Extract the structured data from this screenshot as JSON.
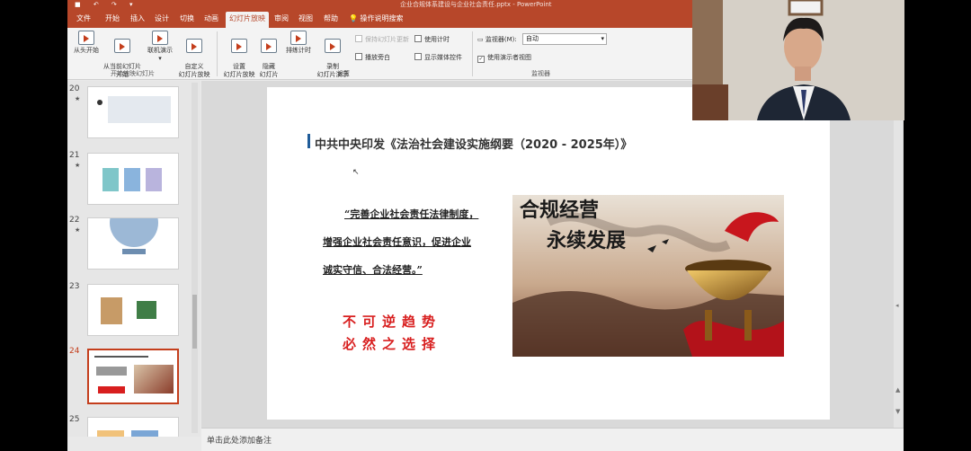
{
  "titlebar": {
    "quick_access": "■ ↶ ↷ ▾",
    "document": "企业合规体系建设与企业社会责任.pptx - PowerPoint"
  },
  "ribbon_tabs": [
    {
      "label": "文件"
    },
    {
      "label": "开始"
    },
    {
      "label": "插入"
    },
    {
      "label": "设计"
    },
    {
      "label": "切换"
    },
    {
      "label": "动画"
    },
    {
      "label": "幻灯片放映",
      "active": true
    },
    {
      "label": "审阅"
    },
    {
      "label": "视图"
    },
    {
      "label": "帮助"
    }
  ],
  "tell_me": "操作说明搜索",
  "ribbon": {
    "start_group": {
      "from_beginning": "从头开始",
      "from_current": "从当前幻灯片\n开始",
      "online": "联机演示",
      "online_arrow": "▾",
      "custom": "自定义\n幻灯片放映",
      "custom_arrow": "▾",
      "label": "开始放映幻灯片"
    },
    "setup_group": {
      "setup": "设置\n幻灯片放映",
      "hide": "隐藏\n幻灯片",
      "rehearse": "排练计时",
      "record": "录制\n幻灯片演示",
      "record_arrow": "▾",
      "play_narration": "播放旁白",
      "use_timings": "使用计时",
      "show_media": "显示媒体控件",
      "keep_updated": "保持幻灯片更新",
      "label": "设置"
    },
    "monitors_group": {
      "monitor_label": "监视器(M):",
      "monitor_value": "自动",
      "presenter_view": "使用演示者视图",
      "label": "监视器"
    }
  },
  "thumbnails": [
    {
      "number": "20",
      "star": "★"
    },
    {
      "number": "21",
      "star": "★"
    },
    {
      "number": "22",
      "star": "★"
    },
    {
      "number": "23",
      "star": ""
    },
    {
      "number": "24",
      "star": "",
      "selected": true
    },
    {
      "number": "25",
      "star": ""
    }
  ],
  "slide": {
    "title": "中共中央印发《法治社会建设实施纲要（2020 - 2025年）》",
    "quote_line1": "“完善企业社会责任法律制度，",
    "quote_line2": "增强企业社会责任意识，促进企业",
    "quote_line3": "诚实守信、合法经营。”",
    "slogan_line1": "不可逆趋势",
    "slogan_line2": "必然之选择",
    "image_text_line1": "合规经营",
    "image_text_line2": "永续发展"
  },
  "notes_placeholder": "单击此处添加备注",
  "scroll": {
    "up": "▲",
    "down": "▼",
    "fit": "◂"
  },
  "colors": {
    "powerpoint_brand": "#b7472a",
    "slogan_red": "#d81e1e",
    "selection": "#c43e1c"
  }
}
